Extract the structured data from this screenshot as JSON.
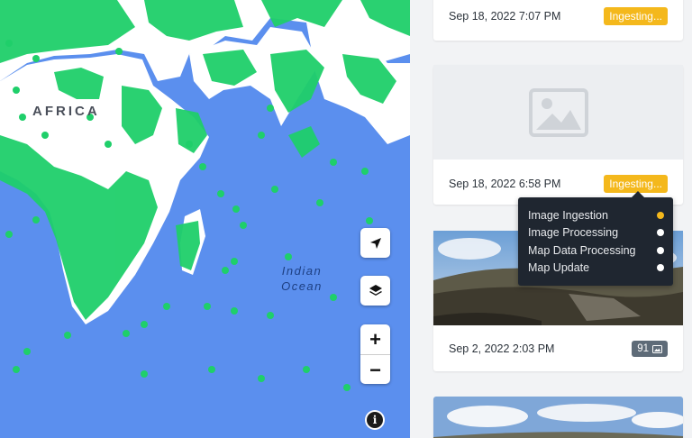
{
  "map": {
    "region_label": "AFRICA",
    "ocean_label_line1": "Indian",
    "ocean_label_line2": "Ocean",
    "controls": {
      "locate_icon": "navigation-arrow-icon",
      "layers_icon": "layers-icon",
      "zoom_in": "+",
      "zoom_out": "−",
      "info": "i"
    },
    "colors": {
      "water": "#5b8fee",
      "land": "#ffffff",
      "coverage": "#1fcf6a"
    }
  },
  "sequences": [
    {
      "date": "Sep 18, 2022 7:07 PM",
      "status": "Ingesting..."
    },
    {
      "date": "Sep 18, 2022 6:58 PM",
      "status": "Ingesting...",
      "thumbnail": "image-placeholder-icon"
    },
    {
      "date": "Sep 2, 2022 2:03 PM",
      "count": "91",
      "thumbnail": "landscape-photo"
    }
  ],
  "tooltip": {
    "steps": [
      {
        "label": "Image Ingestion",
        "state": "active"
      },
      {
        "label": "Image Processing",
        "state": "pending"
      },
      {
        "label": "Map Data Processing",
        "state": "pending"
      },
      {
        "label": "Map Update",
        "state": "pending"
      }
    ]
  },
  "colors": {
    "ingesting_badge": "#f4b81c",
    "count_badge": "#5e6b78",
    "tooltip_bg": "#1f2630"
  }
}
